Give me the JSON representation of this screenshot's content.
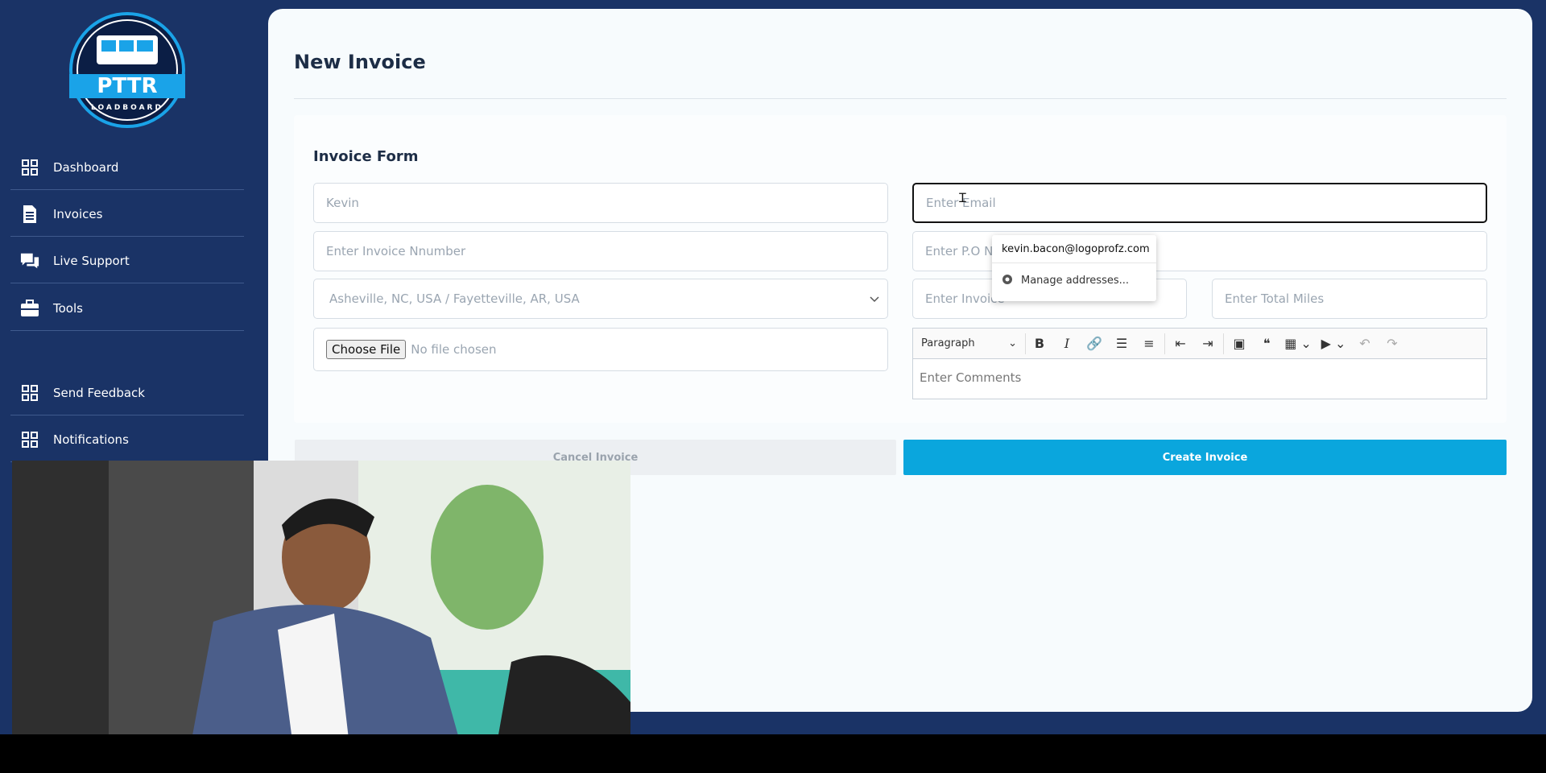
{
  "app": {
    "brand_top": "PTTR",
    "brand_bottom": "LOADBOARD"
  },
  "sidebar": {
    "items": [
      {
        "label": "Dashboard",
        "icon": "grid-icon"
      },
      {
        "label": "Invoices",
        "icon": "document-icon"
      },
      {
        "label": "Live Support",
        "icon": "chat-icon"
      },
      {
        "label": "Tools",
        "icon": "toolbox-icon"
      },
      {
        "label": "Send Feedback",
        "icon": "grid-icon"
      },
      {
        "label": "Notifications",
        "icon": "grid-icon"
      }
    ]
  },
  "page": {
    "title": "New Invoice"
  },
  "form": {
    "title": "Invoice Form",
    "name_value": "Kevin",
    "email_placeholder": "Enter Email",
    "invoice_number_placeholder": "Enter Invoice Nnumber",
    "po_number_placeholder": "Enter P.O Nu",
    "route_value": "Asheville, NC, USA / Fayetteville, AR, USA",
    "invoice_amount_placeholder": "Enter Invoice",
    "total_miles_placeholder": "Enter Total Miles",
    "file_button": "Choose File",
    "file_status": "No file chosen",
    "editor": {
      "style": "Paragraph",
      "placeholder": "Enter Comments"
    }
  },
  "autofill": {
    "suggestion": "kevin.bacon@logoprofz.com",
    "manage": "Manage addresses..."
  },
  "actions": {
    "cancel": "Cancel Invoice",
    "create": "Create Invoice"
  },
  "colors": {
    "sidebar": "#1a3366",
    "primary": "#0aa6dd"
  }
}
